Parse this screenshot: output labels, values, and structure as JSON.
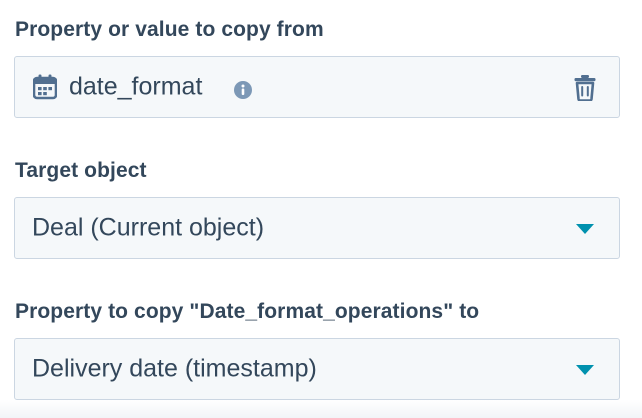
{
  "source": {
    "label": "Property or value to copy from",
    "value": "date_format",
    "icons": {
      "type": "calendar-icon",
      "info": "info-icon",
      "delete": "trash-icon"
    }
  },
  "target_object": {
    "label": "Target object",
    "value": "Deal (Current object)",
    "icon": "caret-down-icon"
  },
  "target_property": {
    "label": "Property to copy \"Date_format_operations\" to",
    "value": "Delivery date (timestamp)",
    "icon": "caret-down-icon"
  },
  "colors": {
    "text": "#33475b",
    "field_bg": "#f5f8fa",
    "field_border": "#cbd6e2",
    "caret": "#0091ae",
    "icon": "#516f90",
    "info_icon": "#7c98b6"
  }
}
